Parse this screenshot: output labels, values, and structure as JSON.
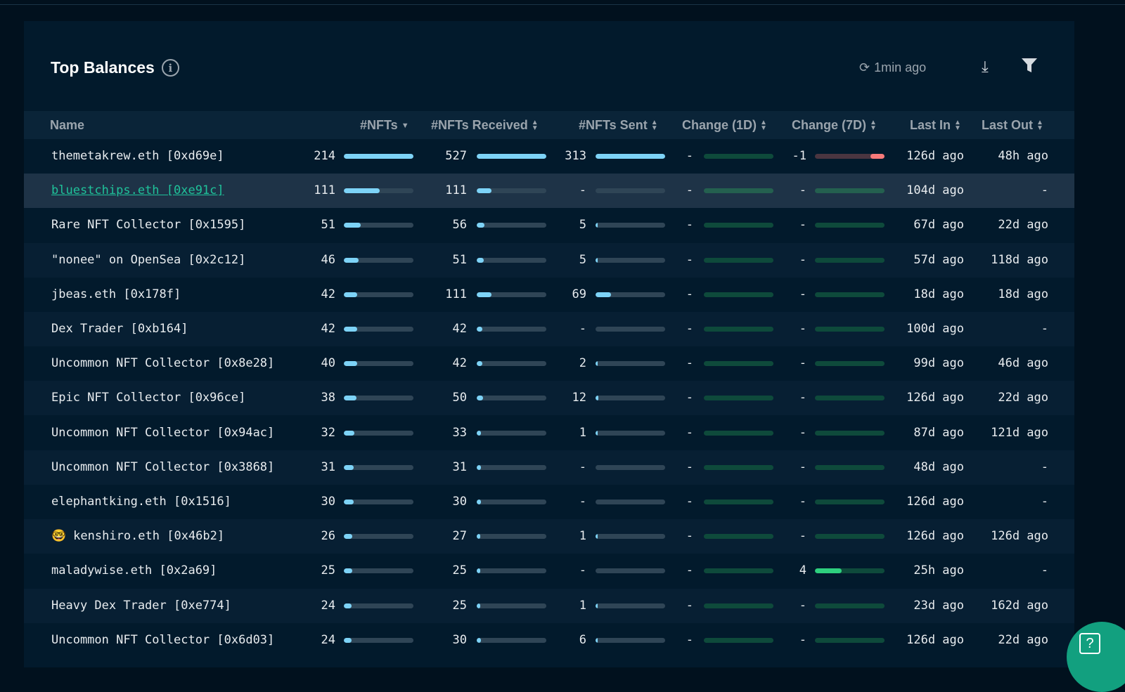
{
  "header": {
    "title": "Top Balances",
    "info_icon": "i",
    "updated": "1min ago"
  },
  "columns": {
    "name": "Name",
    "nfts": "#NFTs",
    "received": "#NFTs Received",
    "sent": "#NFTs Sent",
    "change1d": "Change (1D)",
    "change7d": "Change (7D)",
    "last_in": "Last In",
    "last_out": "Last Out"
  },
  "max": {
    "nfts": 214,
    "received": 527,
    "sent": 313
  },
  "rows": [
    {
      "name": "themetakrew.eth [0xd69e]",
      "nfts": 214,
      "received": 527,
      "sent": 313,
      "change1d": "-",
      "change7d": "-1",
      "last_in": "126d ago",
      "last_out": "48h ago"
    },
    {
      "name": "bluestchips.eth [0xe91c]",
      "nfts": 111,
      "received": 111,
      "sent": "-",
      "change1d": "-",
      "change7d": "-",
      "last_in": "104d ago",
      "last_out": "-",
      "link": true
    },
    {
      "name": "Rare NFT Collector [0x1595]",
      "nfts": 51,
      "received": 56,
      "sent": 5,
      "change1d": "-",
      "change7d": "-",
      "last_in": "67d ago",
      "last_out": "22d ago"
    },
    {
      "name": "\"nonee\" on OpenSea [0x2c12]",
      "nfts": 46,
      "received": 51,
      "sent": 5,
      "change1d": "-",
      "change7d": "-",
      "last_in": "57d ago",
      "last_out": "118d ago"
    },
    {
      "name": "jbeas.eth [0x178f]",
      "nfts": 42,
      "received": 111,
      "sent": 69,
      "change1d": "-",
      "change7d": "-",
      "last_in": "18d ago",
      "last_out": "18d ago"
    },
    {
      "name": "Dex Trader [0xb164]",
      "nfts": 42,
      "received": 42,
      "sent": "-",
      "change1d": "-",
      "change7d": "-",
      "last_in": "100d ago",
      "last_out": "-"
    },
    {
      "name": "Uncommon NFT Collector [0x8e28]",
      "nfts": 40,
      "received": 42,
      "sent": 2,
      "change1d": "-",
      "change7d": "-",
      "last_in": "99d ago",
      "last_out": "46d ago"
    },
    {
      "name": "Epic NFT Collector [0x96ce]",
      "nfts": 38,
      "received": 50,
      "sent": 12,
      "change1d": "-",
      "change7d": "-",
      "last_in": "126d ago",
      "last_out": "22d ago"
    },
    {
      "name": "Uncommon NFT Collector [0x94ac]",
      "nfts": 32,
      "received": 33,
      "sent": 1,
      "change1d": "-",
      "change7d": "-",
      "last_in": "87d ago",
      "last_out": "121d ago"
    },
    {
      "name": "Uncommon NFT Collector [0x3868]",
      "nfts": 31,
      "received": 31,
      "sent": "-",
      "change1d": "-",
      "change7d": "-",
      "last_in": "48d ago",
      "last_out": "-"
    },
    {
      "name": "elephantking.eth [0x1516]",
      "nfts": 30,
      "received": 30,
      "sent": "-",
      "change1d": "-",
      "change7d": "-",
      "last_in": "126d ago",
      "last_out": "-"
    },
    {
      "name": "kenshiro.eth [0x46b2]",
      "emoji": "🤓",
      "nfts": 26,
      "received": 27,
      "sent": 1,
      "change1d": "-",
      "change7d": "-",
      "last_in": "126d ago",
      "last_out": "126d ago"
    },
    {
      "name": "maladywise.eth [0x2a69]",
      "nfts": 25,
      "received": 25,
      "sent": "-",
      "change1d": "-",
      "change7d": "4",
      "last_in": "25h ago",
      "last_out": "-"
    },
    {
      "name": "Heavy Dex Trader [0xe774]",
      "nfts": 24,
      "received": 25,
      "sent": 1,
      "change1d": "-",
      "change7d": "-",
      "last_in": "23d ago",
      "last_out": "162d ago"
    },
    {
      "name": "Uncommon NFT Collector [0x6d03]",
      "nfts": 24,
      "received": 30,
      "sent": 6,
      "change1d": "-",
      "change7d": "-",
      "last_in": "126d ago",
      "last_out": "22d ago"
    }
  ],
  "help": "?"
}
